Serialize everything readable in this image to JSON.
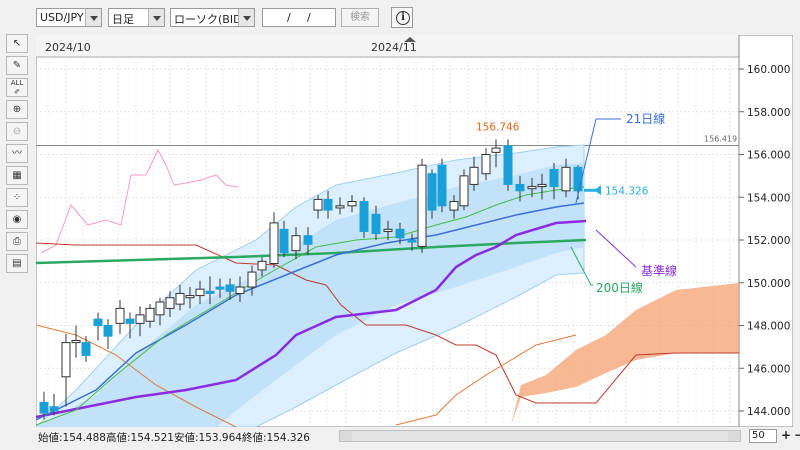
{
  "toolbar": {
    "symbol": "USD/JPY",
    "timeframe": "日足",
    "chart_style": "ローソク(BID)",
    "date_sep1": "/",
    "date_sep2": "/",
    "search_label": "検索",
    "info_label": "i"
  },
  "sidebar": {
    "tools": [
      "cursor-tool",
      "line-tool",
      "all-delete-tool",
      "zoom-in-tool",
      "zoom-out-tool",
      "indicator-tool",
      "object-tool",
      "technical-tool",
      "view-tool",
      "print-tool",
      "settings-tool"
    ],
    "all_label": "ALL"
  },
  "chart": {
    "date_labels": [
      "2024/10",
      "2024/11"
    ],
    "y_ticks": [
      "160.000",
      "158.000",
      "156.000",
      "154.000",
      "152.000",
      "150.000",
      "148.000",
      "146.000",
      "144.000"
    ],
    "high_label": "156.746",
    "prev_level": "156.419",
    "current_price": "154.326",
    "annotations": {
      "ma21": "21日線",
      "kijun": "基準線",
      "ma200": "200日線"
    },
    "colors": {
      "up_candle": "#ffffff",
      "down_candle": "#1aa0d8",
      "ma21": "#3a6fd8",
      "kijun": "#8a2be2",
      "ma200": "#2aa860",
      "cloud": "#f5a070",
      "bollinger": "#9fd0f2",
      "price_tag": "#2ab0e0"
    }
  },
  "status": {
    "open": "始値:154.488",
    "high": "高値:154.521",
    "low": "安値:153.964",
    "close": "終値:154.326",
    "zoom": "50"
  }
}
